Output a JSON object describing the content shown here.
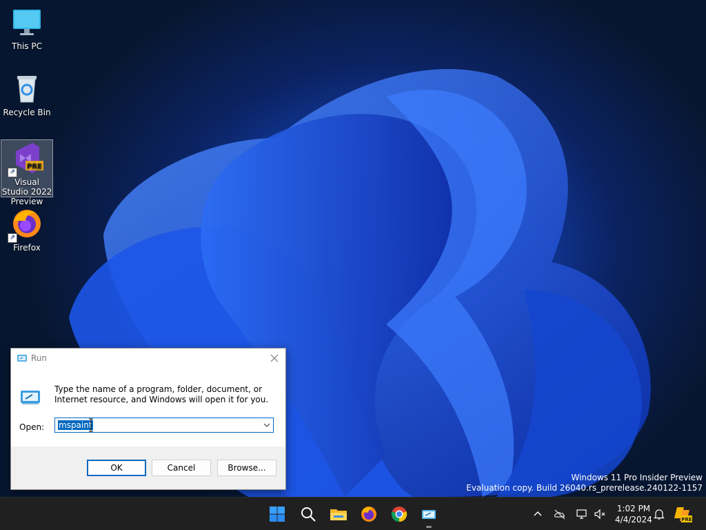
{
  "desktop": {
    "icons": [
      {
        "label": "This PC",
        "icon": "this-pc-icon"
      },
      {
        "label": "Recycle Bin",
        "icon": "recycle-bin-icon"
      },
      {
        "label": "Visual Studio 2022 Preview",
        "icon": "visual-studio-icon",
        "badge": "PRE",
        "selected": true
      },
      {
        "label": "Firefox",
        "icon": "firefox-icon"
      }
    ],
    "watermark": {
      "line1": "Windows 11 Pro Insider Preview",
      "line2": "Evaluation copy. Build 26040.rs_prerelease.240122-1157"
    }
  },
  "run_dialog": {
    "title": "Run",
    "description": "Type the name of a program, folder, document, or Internet resource, and Windows will open it for you.",
    "open_label": "Open:",
    "open_value": "mspaint",
    "buttons": {
      "ok": "OK",
      "cancel": "Cancel",
      "browse": "Browse..."
    }
  },
  "taskbar": {
    "apps": [
      "start-icon",
      "search-icon",
      "file-explorer-icon",
      "firefox-icon",
      "chrome-icon",
      "run-icon"
    ],
    "tray": [
      "chevron-up-icon",
      "onedrive-icon",
      "network-icon",
      "volume-mute-icon",
      "notification-bell-icon",
      "copilot-icon"
    ],
    "time": "1:02 PM",
    "date": "4/4/2024",
    "copilot_badge": "PRE"
  },
  "colors": {
    "accent": "#0067c0",
    "taskbar": "#202020",
    "wallpaper": "#1a4fd6"
  }
}
